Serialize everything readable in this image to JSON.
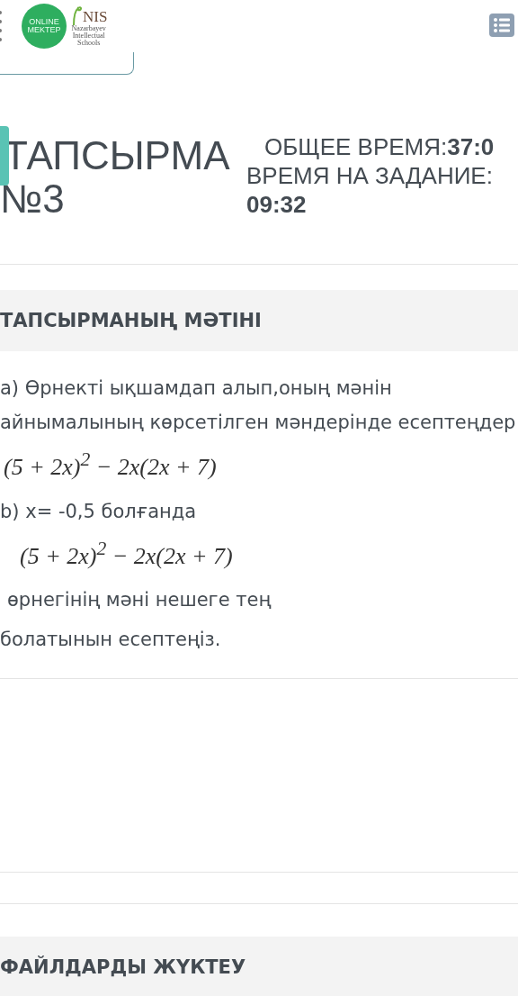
{
  "header": {
    "logo_text": [
      "ONLINE",
      "MEKTEP"
    ],
    "nis_logo": {
      "name": "NIS",
      "subtitle": [
        "Nazarbayev",
        "Intellectual",
        "Schools"
      ]
    }
  },
  "task": {
    "title": "ТАПСЫРМА",
    "number": "№3"
  },
  "timers": [
    {
      "label": "ОБЩЕЕ ВРЕМЯ:",
      "value": "37:0"
    },
    {
      "label": "ВРЕМЯ НА ЗАДАНИЕ:",
      "value": "09:32"
    }
  ],
  "task_text": {
    "heading": "ТАПСЫРМАНЫҢ МӘТІНІ",
    "blocks": [
      {
        "kind": "text",
        "text": "а) Өрнекті ықшамдап алып,оның мәнін"
      },
      {
        "kind": "text",
        "text": "айнымалының көрсетілген мәндерінде есептеңдер"
      },
      {
        "kind": "formula",
        "text": "(5 + 2x)$^{2}$ − 2x(2x + 7)"
      },
      {
        "kind": "text",
        "text": "b) x= -0,5 болғанда"
      },
      {
        "kind": "formula",
        "text": "(5 + 2x)$^{2}$ − 2x(2x + 7)",
        "indent": true
      },
      {
        "kind": "text",
        "text": "өрнегінің мәні нешеге тең",
        "indent": true
      },
      {
        "kind": "text",
        "text": "болатынын есептеңіз."
      }
    ]
  },
  "upload": {
    "heading": "ФАЙЛДАРДЫ ЖҮКТЕУ"
  }
}
